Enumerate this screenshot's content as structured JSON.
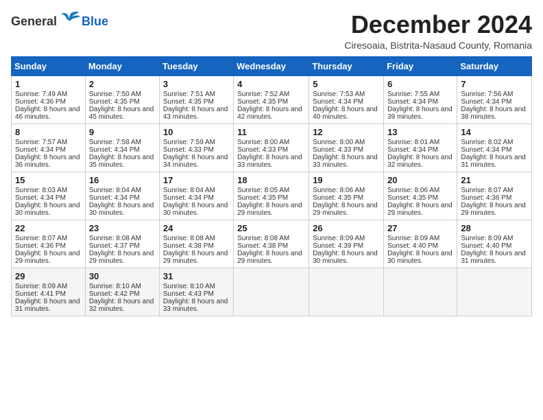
{
  "logo": {
    "general": "General",
    "blue": "Blue"
  },
  "title": "December 2024",
  "subtitle": "Ciresoaia, Bistrita-Nasaud County, Romania",
  "days": [
    "Sunday",
    "Monday",
    "Tuesday",
    "Wednesday",
    "Thursday",
    "Friday",
    "Saturday"
  ],
  "weeks": [
    [
      {
        "day": "1",
        "sunrise": "7:49 AM",
        "sunset": "4:36 PM",
        "daylight": "8 hours and 46 minutes."
      },
      {
        "day": "2",
        "sunrise": "7:50 AM",
        "sunset": "4:35 PM",
        "daylight": "8 hours and 45 minutes."
      },
      {
        "day": "3",
        "sunrise": "7:51 AM",
        "sunset": "4:35 PM",
        "daylight": "8 hours and 43 minutes."
      },
      {
        "day": "4",
        "sunrise": "7:52 AM",
        "sunset": "4:35 PM",
        "daylight": "8 hours and 42 minutes."
      },
      {
        "day": "5",
        "sunrise": "7:53 AM",
        "sunset": "4:34 PM",
        "daylight": "8 hours and 40 minutes."
      },
      {
        "day": "6",
        "sunrise": "7:55 AM",
        "sunset": "4:34 PM",
        "daylight": "8 hours and 39 minutes."
      },
      {
        "day": "7",
        "sunrise": "7:56 AM",
        "sunset": "4:34 PM",
        "daylight": "8 hours and 38 minutes."
      }
    ],
    [
      {
        "day": "8",
        "sunrise": "7:57 AM",
        "sunset": "4:34 PM",
        "daylight": "8 hours and 36 minutes."
      },
      {
        "day": "9",
        "sunrise": "7:58 AM",
        "sunset": "4:34 PM",
        "daylight": "8 hours and 35 minutes."
      },
      {
        "day": "10",
        "sunrise": "7:59 AM",
        "sunset": "4:33 PM",
        "daylight": "8 hours and 34 minutes."
      },
      {
        "day": "11",
        "sunrise": "8:00 AM",
        "sunset": "4:33 PM",
        "daylight": "8 hours and 33 minutes."
      },
      {
        "day": "12",
        "sunrise": "8:00 AM",
        "sunset": "4:33 PM",
        "daylight": "8 hours and 33 minutes."
      },
      {
        "day": "13",
        "sunrise": "8:01 AM",
        "sunset": "4:34 PM",
        "daylight": "8 hours and 32 minutes."
      },
      {
        "day": "14",
        "sunrise": "8:02 AM",
        "sunset": "4:34 PM",
        "daylight": "8 hours and 31 minutes."
      }
    ],
    [
      {
        "day": "15",
        "sunrise": "8:03 AM",
        "sunset": "4:34 PM",
        "daylight": "8 hours and 30 minutes."
      },
      {
        "day": "16",
        "sunrise": "8:04 AM",
        "sunset": "4:34 PM",
        "daylight": "8 hours and 30 minutes."
      },
      {
        "day": "17",
        "sunrise": "8:04 AM",
        "sunset": "4:34 PM",
        "daylight": "8 hours and 30 minutes."
      },
      {
        "day": "18",
        "sunrise": "8:05 AM",
        "sunset": "4:35 PM",
        "daylight": "8 hours and 29 minutes."
      },
      {
        "day": "19",
        "sunrise": "8:06 AM",
        "sunset": "4:35 PM",
        "daylight": "8 hours and 29 minutes."
      },
      {
        "day": "20",
        "sunrise": "8:06 AM",
        "sunset": "4:35 PM",
        "daylight": "8 hours and 29 minutes."
      },
      {
        "day": "21",
        "sunrise": "8:07 AM",
        "sunset": "4:36 PM",
        "daylight": "8 hours and 29 minutes."
      }
    ],
    [
      {
        "day": "22",
        "sunrise": "8:07 AM",
        "sunset": "4:36 PM",
        "daylight": "8 hours and 29 minutes."
      },
      {
        "day": "23",
        "sunrise": "8:08 AM",
        "sunset": "4:37 PM",
        "daylight": "8 hours and 29 minutes."
      },
      {
        "day": "24",
        "sunrise": "8:08 AM",
        "sunset": "4:38 PM",
        "daylight": "8 hours and 29 minutes."
      },
      {
        "day": "25",
        "sunrise": "8:08 AM",
        "sunset": "4:38 PM",
        "daylight": "8 hours and 29 minutes."
      },
      {
        "day": "26",
        "sunrise": "8:09 AM",
        "sunset": "4:39 PM",
        "daylight": "8 hours and 30 minutes."
      },
      {
        "day": "27",
        "sunrise": "8:09 AM",
        "sunset": "4:40 PM",
        "daylight": "8 hours and 30 minutes."
      },
      {
        "day": "28",
        "sunrise": "8:09 AM",
        "sunset": "4:40 PM",
        "daylight": "8 hours and 31 minutes."
      }
    ],
    [
      {
        "day": "29",
        "sunrise": "8:09 AM",
        "sunset": "4:41 PM",
        "daylight": "8 hours and 31 minutes."
      },
      {
        "day": "30",
        "sunrise": "8:10 AM",
        "sunset": "4:42 PM",
        "daylight": "8 hours and 32 minutes."
      },
      {
        "day": "31",
        "sunrise": "8:10 AM",
        "sunset": "4:43 PM",
        "daylight": "8 hours and 33 minutes."
      },
      null,
      null,
      null,
      null
    ]
  ]
}
